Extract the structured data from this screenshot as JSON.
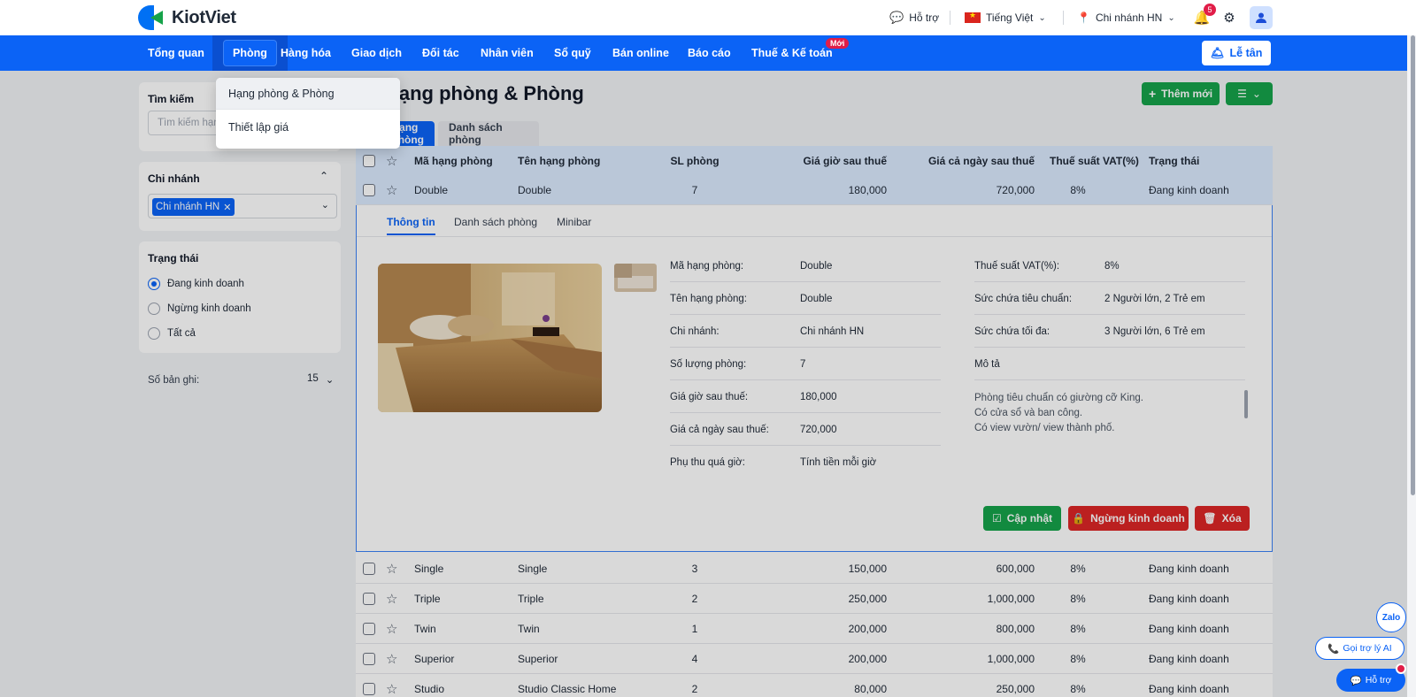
{
  "app": {
    "logo_text": "KiotViet"
  },
  "topbar": {
    "support": "Hỗ trợ",
    "language": "Tiếng Việt",
    "branch": "Chi nhánh HN",
    "notification_count": "5"
  },
  "nav": {
    "items": [
      "Tổng quan",
      "Phòng",
      "Hàng hóa",
      "Giao dịch",
      "Đối tác",
      "Nhân viên",
      "Sổ quỹ",
      "Bán online",
      "Báo cáo",
      "Thuế & Kế toán"
    ],
    "new_badge": "Mới",
    "reception": "Lễ tân"
  },
  "dropdown": {
    "items": [
      "Hạng phòng & Phòng",
      "Thiết lập giá"
    ]
  },
  "sidebar": {
    "search_title": "Tìm kiếm",
    "search_placeholder": "Tìm kiếm hạng phòng",
    "branch_title": "Chi nhánh",
    "branch_chip": "Chi nhánh HN",
    "status_title": "Trạng thái",
    "status_options": [
      "Đang kinh doanh",
      "Ngừng kinh doanh",
      "Tất cả"
    ],
    "records_label": "Số bản ghi:",
    "records_value": "15"
  },
  "main": {
    "title": "Hạng phòng & Phòng",
    "add_button": "Thêm mới",
    "tabs": [
      "Hạng phòng",
      "Danh sách phòng"
    ]
  },
  "table": {
    "headers": [
      "Mã hạng phòng",
      "Tên hạng phòng",
      "SL phòng",
      "Giá giờ sau thuế",
      "Giá cả ngày sau thuế",
      "Thuế suất VAT(%)",
      "Trạng thái"
    ],
    "rows": [
      {
        "code": "Double",
        "name": "Double",
        "qty": "7",
        "hour": "180,000",
        "day": "720,000",
        "vat": "8%",
        "status": "Đang kinh doanh"
      },
      {
        "code": "Single",
        "name": "Single",
        "qty": "3",
        "hour": "150,000",
        "day": "600,000",
        "vat": "8%",
        "status": "Đang kinh doanh"
      },
      {
        "code": "Triple",
        "name": "Triple",
        "qty": "2",
        "hour": "250,000",
        "day": "1,000,000",
        "vat": "8%",
        "status": "Đang kinh doanh"
      },
      {
        "code": "Twin",
        "name": "Twin",
        "qty": "1",
        "hour": "200,000",
        "day": "800,000",
        "vat": "8%",
        "status": "Đang kinh doanh"
      },
      {
        "code": "Superior",
        "name": "Superior",
        "qty": "4",
        "hour": "200,000",
        "day": "1,000,000",
        "vat": "8%",
        "status": "Đang kinh doanh"
      },
      {
        "code": "Studio",
        "name": "Studio Classic Home",
        "qty": "2",
        "hour": "80,000",
        "day": "250,000",
        "vat": "8%",
        "status": "Đang kinh doanh"
      }
    ]
  },
  "detail": {
    "tabs": [
      "Thông tin",
      "Danh sách phòng",
      "Minibar"
    ],
    "left": [
      {
        "k": "Mã hạng phòng:",
        "v": "Double"
      },
      {
        "k": "Tên hạng phòng:",
        "v": "Double"
      },
      {
        "k": "Chi nhánh:",
        "v": "Chi nhánh HN"
      },
      {
        "k": "Số lượng phòng:",
        "v": "7"
      },
      {
        "k": "Giá giờ sau thuế:",
        "v": "180,000"
      },
      {
        "k": "Giá cả ngày sau thuế:",
        "v": "720,000"
      },
      {
        "k": "Phụ thu quá giờ:",
        "v": "Tính tiền mỗi giờ"
      }
    ],
    "right": [
      {
        "k": "Thuế suất VAT(%):",
        "v": "8%"
      },
      {
        "k": "Sức chứa tiêu chuẩn:",
        "v": "2 Người lớn, 2 Trẻ em"
      },
      {
        "k": "Sức chứa tối đa:",
        "v": "3 Người lớn, 6 Trẻ em"
      },
      {
        "k": "Mô tả",
        "v": ""
      }
    ],
    "description": [
      "Phòng tiêu chuẩn có giường cỡ King.",
      "Có cửa sổ và ban công.",
      "Có view vườn/ view thành phố."
    ],
    "buttons": {
      "update": "Cập nhật",
      "stop": "Ngừng kinh doanh",
      "delete": "Xóa"
    }
  },
  "floating": {
    "zalo": "Zalo",
    "ai": "Gọi trợ lý AI",
    "help": "Hỗ trợ"
  },
  "colors": {
    "primary": "#0b63f6",
    "success": "#16a34a",
    "danger": "#dc2626"
  }
}
